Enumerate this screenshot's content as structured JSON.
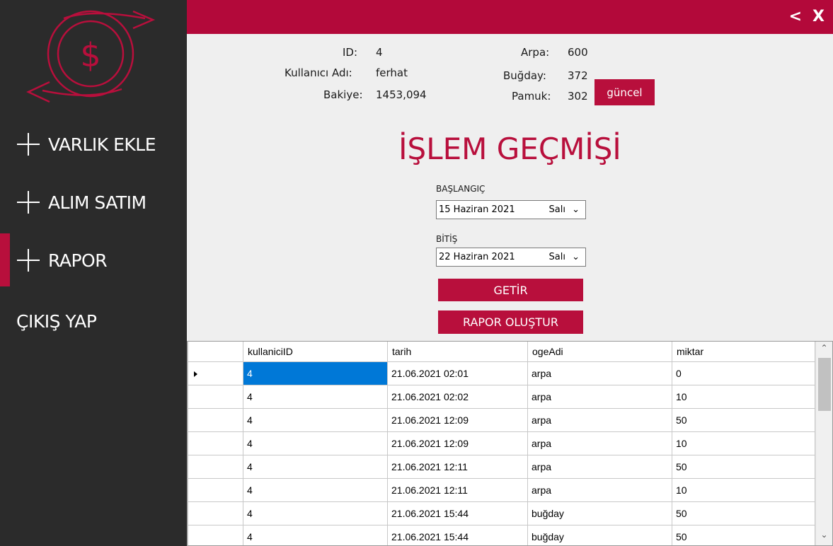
{
  "sidebar": {
    "logo_symbol": "$",
    "items": [
      {
        "label": "VARLIK EKLE"
      },
      {
        "label": "ALIM SATIM"
      },
      {
        "label": "RAPOR"
      }
    ],
    "logout_label": "ÇIKIŞ YAP",
    "active_item": "RAPOR"
  },
  "topbar": {
    "back_label": "<",
    "close_label": "X"
  },
  "user": {
    "id_label": "ID:",
    "id_value": "4",
    "username_label": "Kullanıcı Adı:",
    "username_value": "ferhat",
    "balance_label": "Bakiye:",
    "balance_value": "1453,094"
  },
  "assets": {
    "arpa_label": "Arpa:",
    "arpa_value": "600",
    "bugday_label": "Buğday:",
    "bugday_value": "372",
    "pamuk_label": "Pamuk:",
    "pamuk_value": "302",
    "refresh_label": "güncel"
  },
  "report": {
    "title": "İŞLEM GEÇMİŞİ",
    "start_label": "BAŞLANGIÇ",
    "start_date": "15 Haziran 2021",
    "start_day": "Salı",
    "end_label": "BİTİŞ",
    "end_date": "22 Haziran 2021",
    "end_day": "Salı",
    "fetch_label": "GETİR",
    "create_label": "RAPOR OLUŞTUR"
  },
  "grid": {
    "columns": [
      "kullaniciID",
      "tarih",
      "ogeAdi",
      "miktar"
    ],
    "rows": [
      [
        "4",
        "21.06.2021 02:01",
        "arpa",
        "0"
      ],
      [
        "4",
        "21.06.2021 02:02",
        "arpa",
        "10"
      ],
      [
        "4",
        "21.06.2021 12:09",
        "arpa",
        "50"
      ],
      [
        "4",
        "21.06.2021 12:09",
        "arpa",
        "10"
      ],
      [
        "4",
        "21.06.2021 12:11",
        "arpa",
        "50"
      ],
      [
        "4",
        "21.06.2021 12:11",
        "arpa",
        "10"
      ],
      [
        "4",
        "21.06.2021 15:44",
        "buğday",
        "50"
      ],
      [
        "4",
        "21.06.2021 15:44",
        "buğday",
        "50"
      ]
    ]
  },
  "colors": {
    "accent": "#b80f3c",
    "sidebar_bg": "#2b2b2b",
    "content_bg": "#efefef",
    "selection": "#0078d7"
  }
}
